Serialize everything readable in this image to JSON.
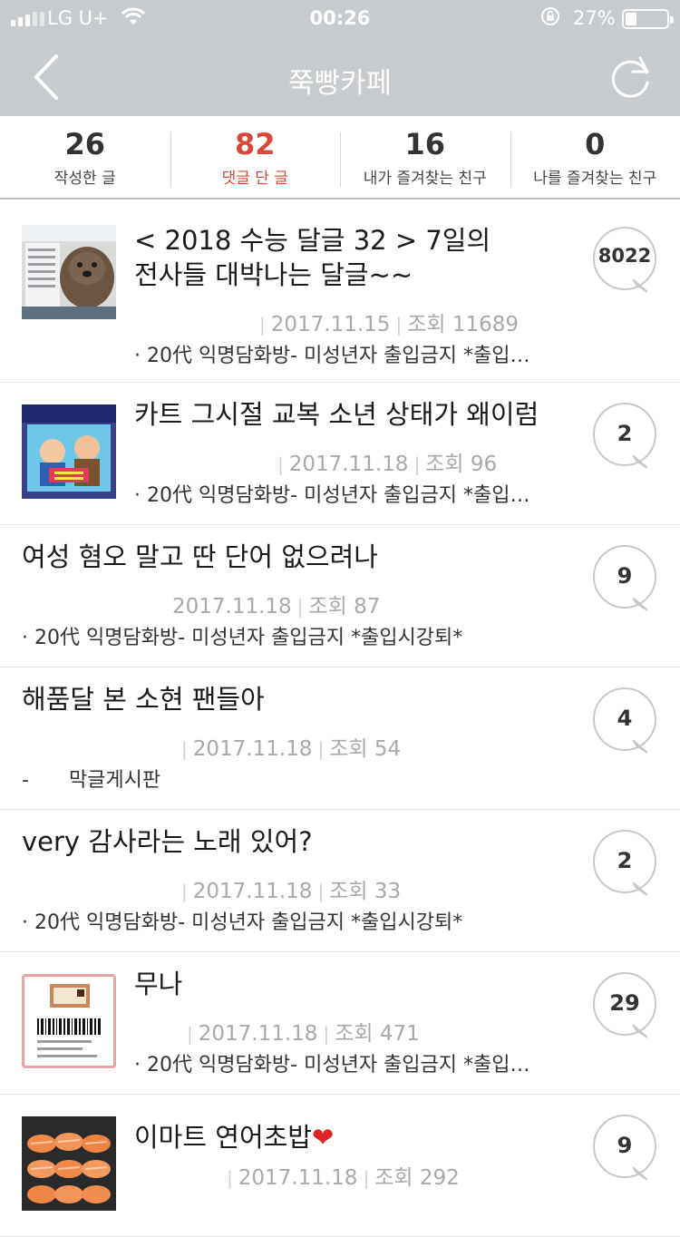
{
  "status": {
    "carrier": "LG U+",
    "time": "00:26",
    "battery": "27%",
    "battery_level": 0.27
  },
  "nav": {
    "title": "쭉빵카페",
    "back_icon": "chevron-left-icon",
    "refresh_icon": "refresh-icon"
  },
  "stats": [
    {
      "num": "26",
      "label": "작성한 글"
    },
    {
      "num": "82",
      "label": "댓글 단 글"
    },
    {
      "num": "16",
      "label": "내가 즐겨찾는 친구"
    },
    {
      "num": "0",
      "label": "나를 즐겨찾는 친구"
    }
  ],
  "colors": {
    "accent": "#d9473b",
    "bar": "#c9ccce"
  },
  "posts": [
    {
      "title_line1": "< 2018 수능 달글 32 > 7일의",
      "title_line2": "전사들 대박나는 달글~~",
      "author": "",
      "date": "2017.11.15",
      "views_label": "조회",
      "views": "11689",
      "board": "· 20代 익명담화방- 미성년자 출입금지 *출입…",
      "comments": "8022"
    },
    {
      "title_line1": "카트 그시절 교복 소년 상태가 왜이럼",
      "author": "",
      "date": "2017.11.18",
      "views_label": "조회",
      "views": "96",
      "board": "· 20代 익명담화방- 미성년자 출입금지 *출입…",
      "comments": "2"
    },
    {
      "title_line1": "여성 혐오 말고 딴 단어 없으려나",
      "author": "",
      "date": "2017.11.18",
      "views_label": "조회",
      "views": "87",
      "board": "· 20代 익명담화방- 미성년자 출입금지 *출입시강퇴*",
      "comments": "9"
    },
    {
      "title_line1": "해품달 본 소현 팬들아",
      "author": "",
      "date": "2017.11.18",
      "views_label": "조회",
      "views": "54",
      "board": "-　　막글게시판",
      "comments": "4"
    },
    {
      "title_line1": "very 감사라는 노래 있어?",
      "author": "",
      "date": "2017.11.18",
      "views_label": "조회",
      "views": "33",
      "board": "· 20代 익명담화방- 미성년자 출입금지 *출입시강퇴*",
      "comments": "2"
    },
    {
      "title_line1": "무나",
      "author": "",
      "date": "2017.11.18",
      "views_label": "조회",
      "views": "471",
      "board": "· 20代 익명담화방- 미성년자 출입금지 *출입…",
      "comments": "29"
    },
    {
      "title_line1": "이마트 연어초밥",
      "title_emoji": "❤",
      "author": "",
      "date": "2017.11.18",
      "views_label": "조회",
      "views": "292",
      "board": "",
      "comments": "9"
    }
  ]
}
